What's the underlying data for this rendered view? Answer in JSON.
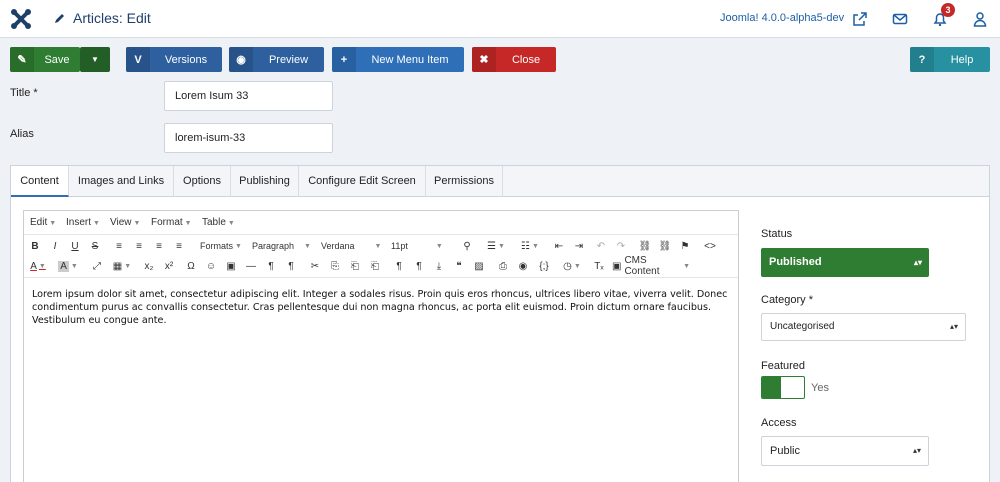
{
  "header": {
    "title": "Articles: Edit",
    "version": "Joomla! 4.0.0-alpha5-dev",
    "notification_count": "3"
  },
  "toolbar": {
    "save": "Save",
    "versions": "Versions",
    "preview": "Preview",
    "new_menu_item": "New Menu Item",
    "close": "Close",
    "help": "Help"
  },
  "form": {
    "title_label": "Title *",
    "title_value": "Lorem Isum 33",
    "alias_label": "Alias",
    "alias_value": "lorem-isum-33"
  },
  "tabs": [
    "Content",
    "Images and Links",
    "Options",
    "Publishing",
    "Configure Edit Screen",
    "Permissions"
  ],
  "editor": {
    "menus": [
      "Edit",
      "Insert",
      "View",
      "Format",
      "Table"
    ],
    "formats": "Formats",
    "block": "Paragraph",
    "font": "Verdana",
    "size": "11pt",
    "cms_content": "CMS Content",
    "body": "Lorem ipsum dolor sit amet, consectetur adipiscing elit. Integer a sodales risus. Proin quis eros rhoncus, ultrices libero vitae, viverra velit. Donec condimentum purus ac convallis consectetur. Cras pellentesque dui non magna rhoncus, ac porta elit euismod. Proin dictum ornare faucibus. Vestibulum eu congue ante."
  },
  "sidebar": {
    "status_label": "Status",
    "status_value": "Published",
    "category_label": "Category *",
    "category_value": "Uncategorised",
    "featured_label": "Featured",
    "featured_value": "Yes",
    "access_label": "Access",
    "access_value": "Public"
  },
  "colors": {
    "success": "#2f7d32",
    "primary": "#2e6fb8",
    "danger": "#c52827",
    "info": "#2791a1",
    "header_text": "#1d3f6a"
  },
  "icons": [
    "joomla-logo-icon",
    "pencil-icon",
    "external-link-icon",
    "mail-icon",
    "bell-icon",
    "user-icon",
    "save-icon",
    "versions-icon",
    "eye-icon",
    "plus-icon",
    "close-icon",
    "question-icon"
  ]
}
